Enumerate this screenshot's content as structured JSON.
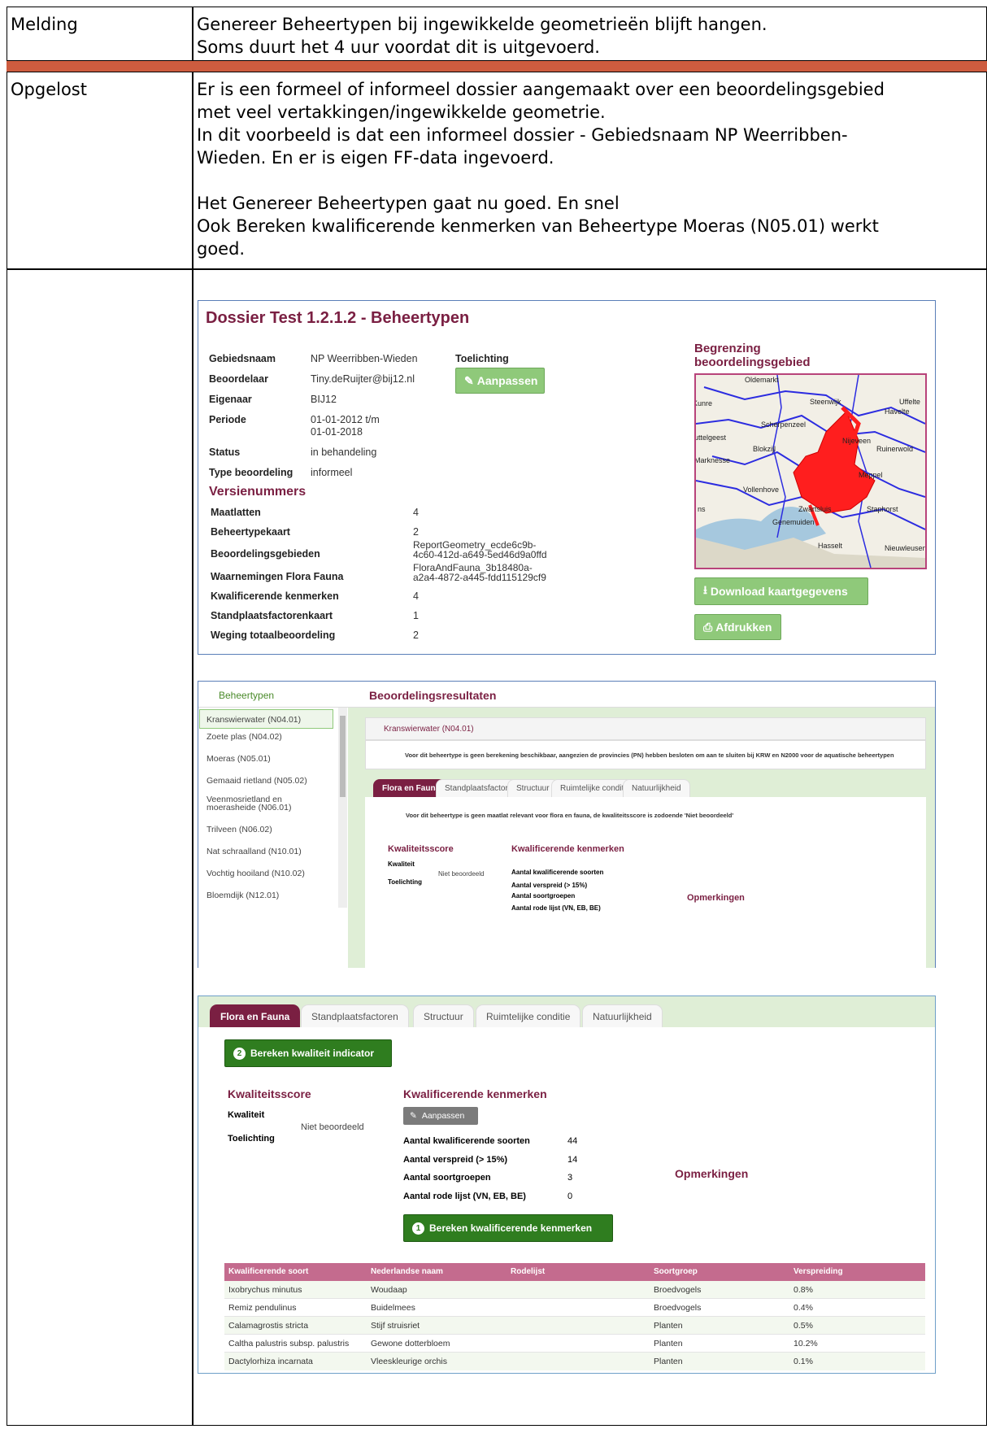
{
  "rows": {
    "melding": {
      "label": "Melding",
      "line1": "Genereer Beheertypen bij ingewikkelde geometrieën blijft hangen.",
      "line2": "Soms duurt het 4 uur voordat dit is uitgevoerd."
    },
    "opgelost": {
      "label": "Opgelost",
      "line1": "Er is een formeel of informeel dossier aangemaakt over een beoordelingsgebied",
      "line2": "met veel vertakkingen/ingewikkelde geometrie.",
      "line3": "In dit voorbeeld is dat een informeel dossier - Gebiedsnaam NP Weerribben-",
      "line4": "Wieden. En er is eigen FF-data ingevoerd.",
      "line5": "Het Genereer Beheertypen gaat nu goed. En snel",
      "line6": "Ook Bereken kwalificerende kenmerken van Beheertype Moeras (N05.01) werkt",
      "line7": "goed."
    }
  },
  "dossier": {
    "title": "Dossier Test 1.2.1.2 - Beheertypen",
    "fields": [
      {
        "label": "Gebiedsnaam",
        "value": "NP Weerribben-Wieden"
      },
      {
        "label": "Beoordelaar",
        "value": "Tiny.deRuijter@bij12.nl"
      },
      {
        "label": "Eigenaar",
        "value": "BIJ12"
      },
      {
        "label": "Periode",
        "value": "01-01-2012 t/m",
        "value2": "01-01-2018"
      },
      {
        "label": "Status",
        "value": "in behandeling"
      },
      {
        "label": "Type beoordeling",
        "value": "informeel"
      }
    ],
    "toelichting_label": "Toelichting",
    "aanpassen_label": "Aanpassen",
    "versie_title": "Versienummers",
    "versies": [
      {
        "label": "Maatlatten",
        "value": "4"
      },
      {
        "label": "Beheertypekaart",
        "value": "2"
      },
      {
        "label": "Beoordelingsgebieden",
        "value": "ReportGeometry_ecde6c9b-",
        "value2": "4c60-412d-a649-5ed46d9a0ffd"
      },
      {
        "label": "Waarnemingen Flora Fauna",
        "value": "FloraAndFauna_3b18480a-",
        "value2": "a2a4-4872-a445-fdd115129cf9"
      },
      {
        "label": "Kwalificerende kenmerken",
        "value": "4"
      },
      {
        "label": "Standplaatsfactorenkaart",
        "value": "1"
      },
      {
        "label": "Weging totaalbeoordeling",
        "value": "2"
      }
    ],
    "map_title_1": "Begrenzing",
    "map_title_2": "beoordelingsgebied",
    "map_labels": [
      "Oldemarkt",
      "Kunre",
      "Steenwijk",
      "Uffelte",
      "Havelte",
      "Scherpenzeel",
      "uttelgeest",
      "Nijeveen",
      "Blokzijl",
      "Ruinerwold",
      "Marknesse",
      "Meppel",
      "Vollenhove",
      "Staphorst",
      "Zwartsluis",
      "Genemuiden",
      "Hasselt",
      "Nieuwleusen",
      "ns"
    ],
    "download_label": "Download kaartgegevens",
    "print_label": "Afdrukken"
  },
  "resultaten": {
    "left_title": "Beheertypen",
    "right_title": "Beoordelingsresultaten",
    "list": [
      "Kranswierwater (N04.01)",
      "Zoete plas (N04.02)",
      "Moeras (N05.01)",
      "Gemaaid rietland (N05.02)",
      "Veenmosrietland en moerasheide (N06.01)",
      "Trilveen (N06.02)",
      "Nat schraalland (N10.01)",
      "Vochtig hooiland (N10.02)",
      "Bloemdijk (N12.01)"
    ],
    "selected_header": "Kranswierwater (N04.01)",
    "notice": "Voor dit beheertype is geen berekening beschikbaar, aangezien de provincies (PN) hebben besloten om aan te sluiten bij KRW en N2000 voor de aquatische beheertypen",
    "tabs": [
      "Flora en Fauna",
      "Standplaatsfactoren",
      "Structuur",
      "Ruimtelijke conditie",
      "Natuurlijkheid"
    ],
    "ff_notice": "Voor dit beheertype is geen maatlat relevant voor flora en fauna, de kwaliteitsscore is zodoende 'Niet beoordeeld'",
    "kwaliteitsscore": "Kwaliteitsscore",
    "kwaliteit": "Kwaliteit",
    "toelichting": "Toelichting",
    "niet_beoordeeld": "Niet beoordeeld",
    "kk_title": "Kwalificerende kenmerken",
    "kk_items": [
      "Aantal kwalificerende soorten",
      "Aantal verspreid (> 15%)",
      "Aantal soortgroepen",
      "Aantal rode lijst (VN, EB, BE)"
    ],
    "opmerkingen": "Opmerkingen"
  },
  "detail": {
    "tabs": [
      "Flora en Fauna",
      "Standplaatsfactoren",
      "Structuur",
      "Ruimtelijke conditie",
      "Natuurlijkheid"
    ],
    "bereken_kwaliteit": "Bereken kwaliteit indicator",
    "step2": "2",
    "step1": "1",
    "kwaliteitsscore": "Kwaliteitsscore",
    "kwaliteit": "Kwaliteit",
    "toelichting": "Toelichting",
    "niet_beoordeeld": "Niet beoordeeld",
    "kk_title": "Kwalificerende kenmerken",
    "aanpassen": "Aanpassen",
    "kk_items": [
      {
        "label": "Aantal kwalificerende soorten",
        "value": "44"
      },
      {
        "label": "Aantal verspreid (> 15%)",
        "value": "14"
      },
      {
        "label": "Aantal soortgroepen",
        "value": "3"
      },
      {
        "label": "Aantal rode lijst (VN, EB, BE)",
        "value": "0"
      }
    ],
    "opmerkingen": "Opmerkingen",
    "bereken_kk": "Bereken kwalificerende kenmerken",
    "table_headers": [
      "Kwalificerende soort",
      "Nederlandse naam",
      "Rodelijst",
      "Soortgroep",
      "Verspreiding"
    ],
    "table_rows": [
      [
        "Ixobrychus minutus",
        "Woudaap",
        "",
        "Broedvogels",
        "0.8%"
      ],
      [
        "Remiz pendulinus",
        "Buidelmees",
        "",
        "Broedvogels",
        "0.4%"
      ],
      [
        "Calamagrostis stricta",
        "Stijf struisriet",
        "",
        "Planten",
        "0.5%"
      ],
      [
        "Caltha palustris subsp. palustris",
        "Gewone dotterbloem",
        "",
        "Planten",
        "10.2%"
      ],
      [
        "Dactylorhiza incarnata",
        "Vleeskleurige orchis",
        "",
        "Planten",
        "0.1%"
      ]
    ]
  }
}
